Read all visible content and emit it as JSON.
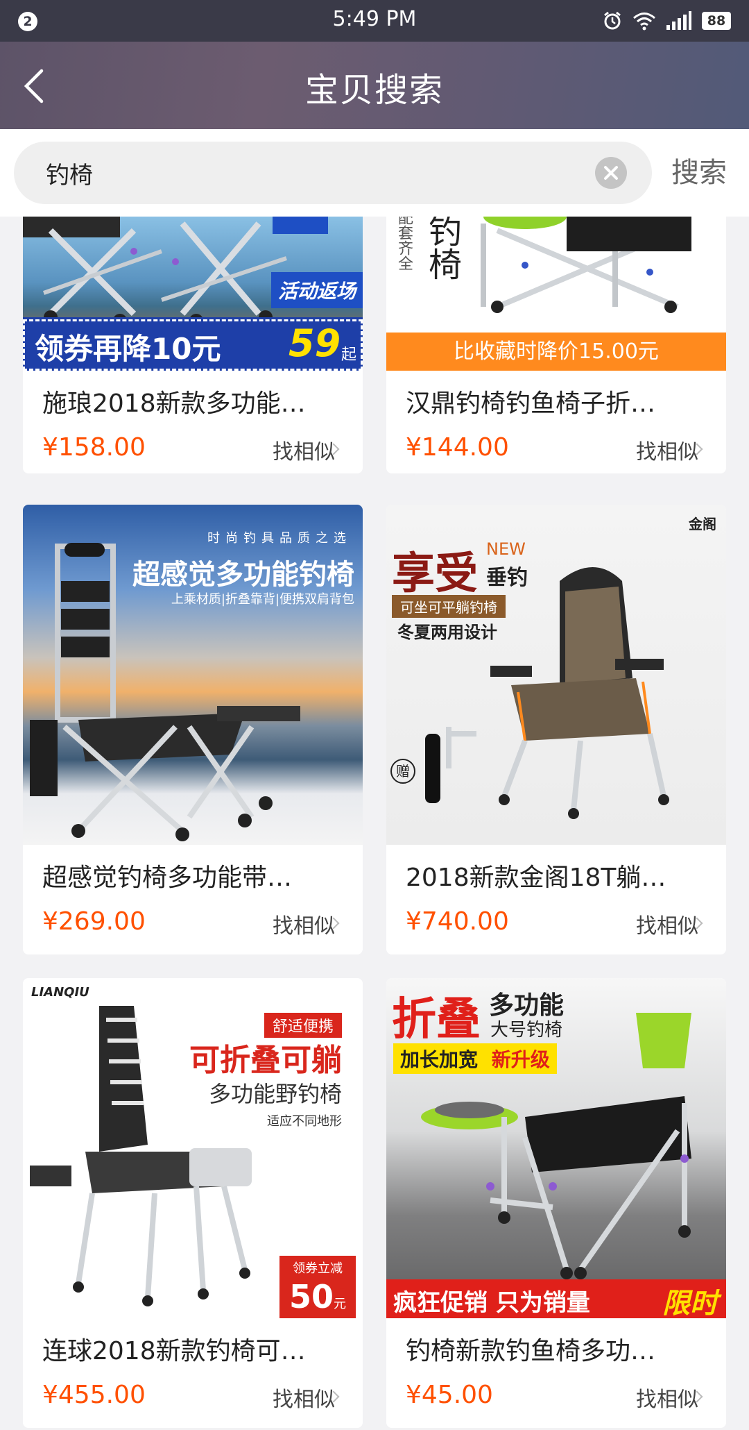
{
  "status_bar": {
    "notification_count": "2",
    "time": "5:49 PM",
    "battery": "88"
  },
  "nav": {
    "title": "宝贝搜索"
  },
  "search": {
    "query": "钓椅",
    "button_label": "搜索"
  },
  "products": [
    {
      "name": "施琅2018新款多功能…",
      "price": "¥158.00",
      "similar": "找相似",
      "banner_text": "领券再降10元",
      "banner_price": "59",
      "banner_suffix": "起",
      "badge": "活动返场"
    },
    {
      "name": "汉鼎钓椅钓鱼椅子折…",
      "price": "¥144.00",
      "similar": "找相似",
      "banner_text": "比收藏时降价15.00元",
      "side_text": "钓椅",
      "side_small": "配套齐全"
    },
    {
      "name": "超感觉钓椅多功能带…",
      "price": "¥269.00",
      "similar": "找相似",
      "img_top": "时尚钓具品质之选",
      "img_title": "超感觉多功能钓椅",
      "img_sub": "上乘材质|折叠靠背|便携双肩背包"
    },
    {
      "name": "2018新款金阁18T躺…",
      "price": "¥740.00",
      "similar": "找相似",
      "img_brand": "金阁",
      "img_title": "享受",
      "img_new": "NEW",
      "img_sub": "垂钓",
      "img_tag": "可坐可平躺钓椅",
      "img_line": "冬夏两用设计",
      "img_gift": "赠"
    },
    {
      "name": "连球2018新款钓椅可…",
      "price": "¥455.00",
      "similar": "找相似",
      "img_brand": "LIANQIU",
      "img_tag": "舒适便携",
      "img_title": "可折叠可躺",
      "img_sub": "多功能野钓椅",
      "img_line": "适应不同地形",
      "coupon_top": "领券立减",
      "coupon_value": "50",
      "coupon_unit": "元"
    },
    {
      "name": "钓椅新款钓鱼椅多功…",
      "price": "¥45.00",
      "similar": "找相似",
      "img_title": "折叠",
      "img_sub": "多功能",
      "img_line": "大号钓椅",
      "img_tag": "加长加宽",
      "img_tag2": "新升级",
      "banner_text": "疯狂促销 只为销量",
      "banner_hot": "限时"
    }
  ],
  "colors": {
    "price": "#ff5000",
    "nav_bg": "#5f5870",
    "accent_blue": "#1e3fa8",
    "accent_orange": "#ff8a1e"
  }
}
